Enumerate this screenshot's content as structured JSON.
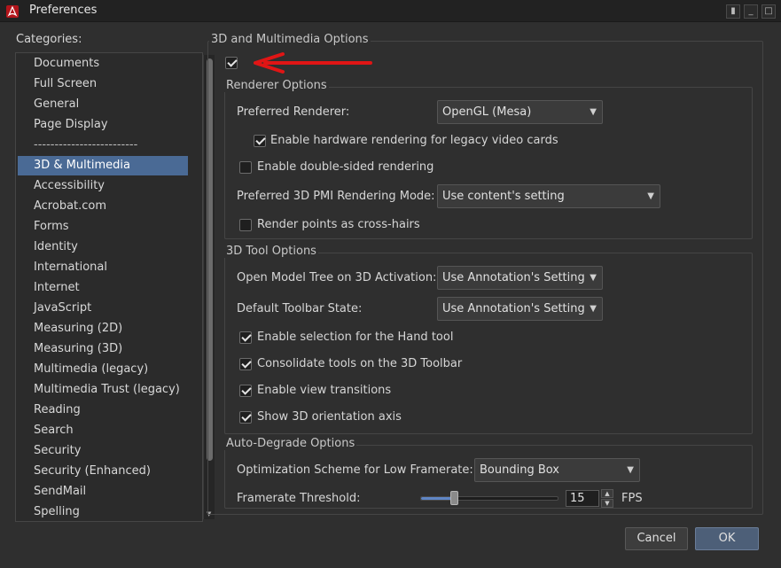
{
  "window": {
    "title": "Preferences",
    "icon": "pdf-app-icon",
    "controls": [
      "restore-icon",
      "minimize-icon",
      "close-icon"
    ]
  },
  "categories": {
    "label": "Categories:",
    "selected": "3D & Multimedia",
    "items": [
      "Documents",
      "Full Screen",
      "General",
      "Page Display",
      "-------------------------",
      "3D & Multimedia",
      "Accessibility",
      "Acrobat.com",
      "Forms",
      "Identity",
      "International",
      "Internet",
      "JavaScript",
      "Measuring (2D)",
      "Measuring (3D)",
      "Multimedia (legacy)",
      "Multimedia Trust (legacy)",
      "Reading",
      "Search",
      "Security",
      "Security (Enhanced)",
      "SendMail",
      "Spelling"
    ]
  },
  "main": {
    "title": "3D and Multimedia Options",
    "enable_3d_checked": true,
    "annotation": {
      "type": "red-arrow-pointing-left",
      "color": "#e01515"
    },
    "renderer": {
      "title": "Renderer Options",
      "preferred_renderer_label": "Preferred Renderer:",
      "preferred_renderer_value": "OpenGL (Mesa)",
      "hw_legacy_label": "Enable hardware rendering for legacy video cards",
      "hw_legacy_checked": true,
      "double_sided_label": "Enable double-sided rendering",
      "double_sided_checked": false,
      "pmi_mode_label": "Preferred 3D PMI Rendering Mode:",
      "pmi_mode_value": "Use content's setting",
      "crosshairs_label": "Render points as cross-hairs",
      "crosshairs_checked": false
    },
    "tool": {
      "title": "3D Tool Options",
      "model_tree_label": "Open Model Tree on 3D Activation:",
      "model_tree_value": "Use Annotation's Setting",
      "toolbar_state_label": "Default Toolbar State:",
      "toolbar_state_value": "Use Annotation's Setting",
      "hand_tool_label": "Enable selection for the Hand tool",
      "hand_tool_checked": true,
      "consolidate_label": "Consolidate tools on the 3D Toolbar",
      "consolidate_checked": true,
      "view_transitions_label": "Enable view transitions",
      "view_transitions_checked": true,
      "orientation_axis_label": "Show 3D orientation axis",
      "orientation_axis_checked": true
    },
    "degrade": {
      "title": "Auto-Degrade Options",
      "scheme_label": "Optimization Scheme for Low Framerate:",
      "scheme_value": "Bounding Box",
      "threshold_label": "Framerate Threshold:",
      "threshold_value": "15",
      "threshold_fraction": 0.24,
      "fps_label": "FPS"
    }
  },
  "buttons": {
    "cancel": "Cancel",
    "ok": "OK"
  },
  "colors": {
    "selection": "#4a6a95",
    "annotation_arrow": "#e01515",
    "slider_fill": "#5f86c5"
  }
}
